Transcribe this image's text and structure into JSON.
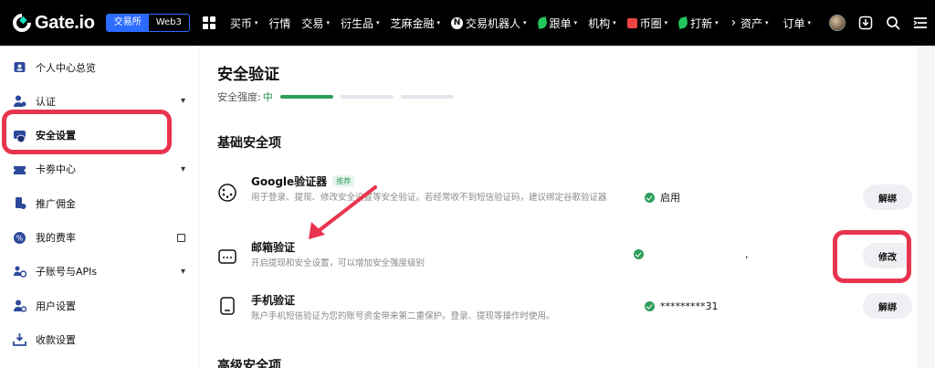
{
  "header": {
    "logo_text": "Gate.io",
    "segment": [
      "交易所",
      "Web3"
    ],
    "nav": [
      {
        "label": "买币",
        "caret": true,
        "icon": ""
      },
      {
        "label": "行情",
        "caret": false,
        "icon": ""
      },
      {
        "label": "交易",
        "caret": true,
        "icon": ""
      },
      {
        "label": "衍生品",
        "caret": true,
        "icon": ""
      },
      {
        "label": "芝麻金融",
        "caret": true,
        "icon": ""
      },
      {
        "label": "交易机器人",
        "caret": true,
        "icon": "n-badge-icon"
      },
      {
        "label": "跟单",
        "caret": true,
        "icon": "leaf-icon"
      },
      {
        "label": "机构",
        "caret": true,
        "icon": ""
      },
      {
        "label": "币圈",
        "caret": true,
        "icon": "chart-bars-icon"
      },
      {
        "label": "打新",
        "caret": true,
        "icon": "leaf-icon"
      }
    ],
    "right": [
      {
        "label": "资产",
        "caret": true
      },
      {
        "label": "订单",
        "caret": true
      }
    ],
    "n_badge": "N",
    "caret_glyph": "▾",
    "more_glyph": "›"
  },
  "sidebar": {
    "items": [
      {
        "label": "个人中心总览",
        "icon": "profile-card-icon",
        "suffix": ""
      },
      {
        "label": "认证",
        "icon": "user-verify-icon",
        "suffix": "chevron"
      },
      {
        "label": "安全设置",
        "icon": "shield-icon",
        "suffix": "",
        "active": true
      },
      {
        "label": "卡劵中心",
        "icon": "ticket-icon",
        "suffix": "chevron"
      },
      {
        "label": "推广佣金",
        "icon": "referral-icon",
        "suffix": ""
      },
      {
        "label": "我的费率",
        "icon": "fee-rate-icon",
        "suffix": "external"
      },
      {
        "label": "子账号与APIs",
        "icon": "sub-account-icon",
        "suffix": "chevron"
      },
      {
        "label": "用户设置",
        "icon": "user-settings-icon",
        "suffix": ""
      },
      {
        "label": "收款设置",
        "icon": "download-tray-icon",
        "suffix": ""
      }
    ],
    "chevron_glyph": "▾"
  },
  "main": {
    "title": "安全验证",
    "strength_label": "安全强度:",
    "strength_level": "中",
    "strength": {
      "filled": 1,
      "total": 3
    },
    "section_basic": "基础安全项",
    "section_advanced": "高级安全项",
    "items": [
      {
        "name": "Google验证器",
        "tag": "推荐",
        "desc": "用于登录、提现、修改安全设置等安全验证。若经常收不到短信验证码，建议绑定谷歌验证器",
        "status": "启用",
        "button": "解绑",
        "icon": "google-authenticator-icon"
      },
      {
        "name": "邮箱验证",
        "tag": "",
        "desc": "开启提现和安全设置，可以增加安全强度级别",
        "status": ",",
        "button": "修改",
        "icon": "email-icon"
      },
      {
        "name": "手机验证",
        "tag": "",
        "desc": "账户手机短信验证为您的账号资金带来第二重保护。登录、提现等操作时使用。",
        "status": "*********31",
        "button": "解绑",
        "icon": "phone-icon"
      }
    ]
  },
  "colors": {
    "accent_red": "#e8344e",
    "success_green": "#2e9e5b",
    "brand_blue": "#2c6bff"
  }
}
